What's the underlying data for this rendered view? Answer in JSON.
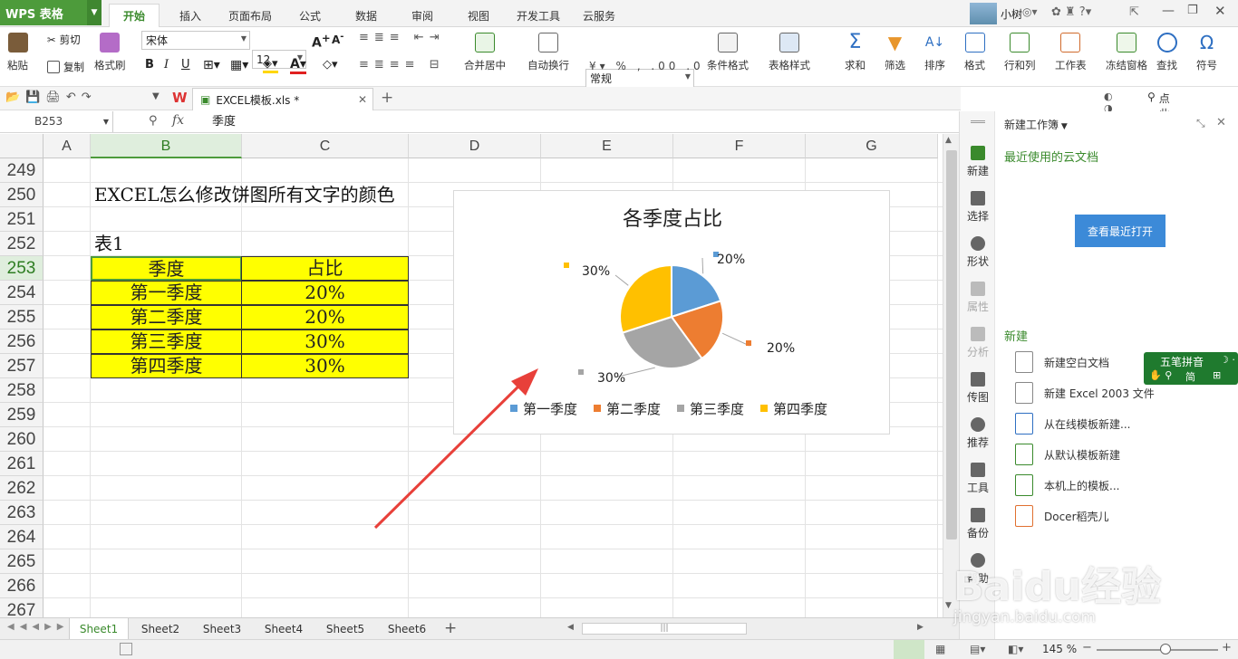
{
  "app": {
    "name": "WPS 表格"
  },
  "menu_tabs": [
    "开始",
    "插入",
    "页面布局",
    "公式",
    "数据",
    "审阅",
    "视图",
    "开发工具",
    "云服务"
  ],
  "user": {
    "name": "小树"
  },
  "ribbon": {
    "paste": "粘贴",
    "cut": "剪切",
    "copy": "复制",
    "format_painter": "格式刷",
    "font_name": "宋体",
    "font_size": "12",
    "merge_center": "合并居中",
    "wrap_text": "自动换行",
    "number_format": "常规",
    "conditional_format": "条件格式",
    "table_style": "表格样式",
    "sum": "求和",
    "filter": "筛选",
    "sort": "排序",
    "format": "格式",
    "rows_cols": "行和列",
    "worksheet": "工作表",
    "freeze": "冻结窗格",
    "find": "查找",
    "symbol": "符号"
  },
  "doc_tab": {
    "title": "EXCEL模板.xls *"
  },
  "search_hint": "点此查找命令",
  "formula_bar": {
    "name_box": "B253",
    "fx": "fx",
    "content": "季度"
  },
  "columns": [
    "A",
    "B",
    "C",
    "D",
    "E",
    "F",
    "G"
  ],
  "rows": [
    "249",
    "250",
    "251",
    "252",
    "253",
    "254",
    "255",
    "256",
    "257",
    "258",
    "259",
    "260",
    "261",
    "262",
    "263",
    "264",
    "265",
    "266",
    "267"
  ],
  "sheet": {
    "heading": "EXCEL怎么修改饼图所有文字的颜色",
    "table_label": "表1",
    "table_header": [
      "季度",
      "占比"
    ],
    "table_rows": [
      [
        "第一季度",
        "20%"
      ],
      [
        "第二季度",
        "20%"
      ],
      [
        "第三季度",
        "30%"
      ],
      [
        "第四季度",
        "30%"
      ]
    ]
  },
  "chart_data": {
    "type": "pie",
    "title": "各季度占比",
    "categories": [
      "第一季度",
      "第二季度",
      "第三季度",
      "第四季度"
    ],
    "values": [
      20,
      20,
      30,
      30
    ],
    "labels": [
      "20%",
      "20%",
      "30%",
      "30%"
    ],
    "colors": [
      "#5b9bd5",
      "#ed7d31",
      "#a5a5a5",
      "#ffc000"
    ],
    "legend": "bottom"
  },
  "sheet_tabs": [
    "Sheet1",
    "Sheet2",
    "Sheet3",
    "Sheet4",
    "Sheet5",
    "Sheet6"
  ],
  "side_strip": [
    "新建",
    "选择",
    "形状",
    "属性",
    "分析",
    "传图",
    "推荐",
    "工具",
    "备份",
    "帮助"
  ],
  "task_pane": {
    "title": "新建工作簿",
    "recent_cloud": "最近使用的云文档",
    "open_recent_btn": "查看最近打开",
    "new_section": "新建",
    "items": [
      "新建空白文档",
      "新建 Excel 2003 文件",
      "从在线模板新建...",
      "从默认模板新建",
      "本机上的模板...",
      "Docer稻壳儿"
    ]
  },
  "ime": {
    "name": "五笔拼音",
    "mode": "简"
  },
  "status": {
    "zoom": "145 %"
  },
  "watermark": {
    "brand": "Baidu经验",
    "url": "jingyan.baidu.com"
  },
  "colors": {
    "accent": "#4d9b3b",
    "highlight": "#ffff00",
    "arrow": "#e8403a",
    "button": "#3c8ad8"
  }
}
